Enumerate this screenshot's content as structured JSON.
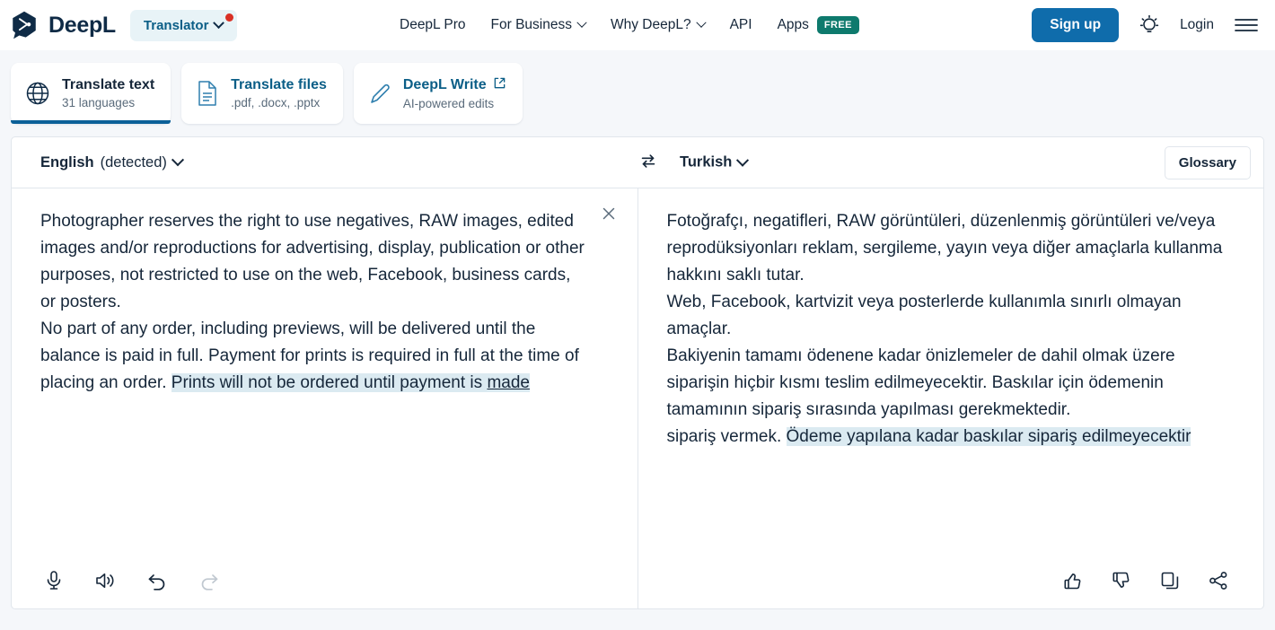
{
  "header": {
    "brand_name": "DeepL",
    "logo_icon": "deepl-logo-icon",
    "product_pill": {
      "label": "Translator",
      "chevron_icon": "chevron-down-icon",
      "notification_dot": true
    },
    "nav": [
      {
        "label": "DeepL Pro",
        "has_chevron": false,
        "badge": ""
      },
      {
        "label": "For Business",
        "has_chevron": true,
        "badge": ""
      },
      {
        "label": "Why DeepL?",
        "has_chevron": true,
        "badge": ""
      },
      {
        "label": "API",
        "has_chevron": false,
        "badge": ""
      },
      {
        "label": "Apps",
        "has_chevron": false,
        "badge": "FREE"
      }
    ],
    "signup_label": "Sign up",
    "login_label": "Login",
    "theme_icon": "lightbulb-icon",
    "menu_icon": "hamburger-menu-icon"
  },
  "tabs": [
    {
      "title": "Translate text",
      "subtitle": "31 languages",
      "icon": "globe-icon",
      "active": true,
      "external": false
    },
    {
      "title": "Translate files",
      "subtitle": ".pdf, .docx, .pptx",
      "icon": "document-icon",
      "active": false,
      "external": false
    },
    {
      "title": "DeepL Write",
      "subtitle": "AI-powered edits",
      "icon": "pencil-icon",
      "active": false,
      "external": true
    }
  ],
  "translator": {
    "source_language": "English",
    "source_language_note": "(detected)",
    "target_language": "Turkish",
    "swap_icon": "swap-arrows-icon",
    "glossary_label": "Glossary",
    "clear_icon": "close-icon",
    "source_text_before": "Photographer reserves the right to use negatives, RAW images, edited images and/or reproductions for advertising, display, publication or other\npurposes, not restricted to use on the web, Facebook, business cards, or posters.\nNo part of any order, including previews, will be delivered until the balance is paid in full. Payment for prints is required in full at the time of\nplacing an order. ",
    "source_text_highlight": "Prints will not be ordered until payment is ",
    "source_text_highlight_underlined": "made",
    "target_text_before": "Fotoğrafçı, negatifleri, RAW görüntüleri, düzenlenmiş görüntüleri ve/veya reprodüksiyonları reklam, sergileme, yayın veya diğer amaçlarla kullanma hakkını saklı tutar.\nWeb, Facebook, kartvizit veya posterlerde kullanımla sınırlı olmayan amaçlar.\nBakiyenin tamamı ödenene kadar önizlemeler de dahil olmak üzere siparişin hiçbir kısmı teslim edilmeyecektir. Baskılar için ödemenin tamamının sipariş sırasında yapılması gerekmektedir.\nsipariş vermek. ",
    "target_text_highlight": "Ödeme yapılana kadar baskılar sipariş edilmeyecektir",
    "source_tools": [
      {
        "icon": "microphone-icon",
        "disabled": false
      },
      {
        "icon": "speaker-icon",
        "disabled": false
      },
      {
        "icon": "undo-icon",
        "disabled": false
      },
      {
        "icon": "redo-icon",
        "disabled": true
      }
    ],
    "target_tools": [
      {
        "icon": "thumbs-up-icon",
        "disabled": false
      },
      {
        "icon": "thumbs-down-icon",
        "disabled": false
      },
      {
        "icon": "copy-icon",
        "disabled": false
      },
      {
        "icon": "share-icon",
        "disabled": false
      }
    ]
  },
  "colors": {
    "brand_dark": "#0f2b46",
    "accent_blue": "#0f6cab",
    "tab_underline": "#0b6098",
    "teal_badge": "#0e7a6d",
    "notification_red": "#d93025",
    "highlight": "#dbeaf1",
    "page_bg": "#f5f7fa"
  }
}
